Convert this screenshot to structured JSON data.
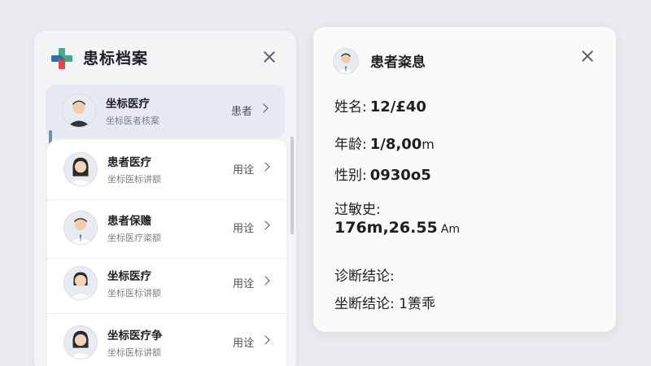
{
  "left_panel": {
    "title": "患标档案",
    "patients": [
      {
        "name": "坐标医疗",
        "subtitle": "坐标医者核案",
        "tag": "患者"
      },
      {
        "name": "患者医疗",
        "subtitle": "坐标医标讲额",
        "tag": "用诠"
      },
      {
        "name": "患者保赡",
        "subtitle": "坐标医疗粢额",
        "tag": "用诠"
      },
      {
        "name": "坐标医疗",
        "subtitle": "坐标医标讲额",
        "tag": "用诠"
      },
      {
        "name": "坐标医疗争",
        "subtitle": "坐标医标讲额",
        "tag": "用诠"
      }
    ]
  },
  "detail_panel": {
    "title": "患者粢息",
    "name_label": "姓名:",
    "name_value": "12/£40",
    "age_label": "年龄:",
    "age_value": "1/8,00",
    "age_unit": "m",
    "gender_label": "性别:",
    "gender_value": "0930o5",
    "allergy_label": "过敏史:",
    "allergy_value": "176m,26.55",
    "allergy_unit": "Am",
    "diagnosis_label": "诊断结论:",
    "diagnosis_row_label": "坐断结论:",
    "diagnosis_row_value": "1箦乖"
  },
  "colors": {
    "logo_green": "#3fae8c",
    "logo_blue": "#2e6fb0",
    "logo_red": "#e04848",
    "selected_row_bg": "#e6e9ef",
    "scroll_indicator": "#6e8fae"
  },
  "icons": [
    "medical-cross-logo-icon",
    "close-icon",
    "chevron-right-icon"
  ]
}
